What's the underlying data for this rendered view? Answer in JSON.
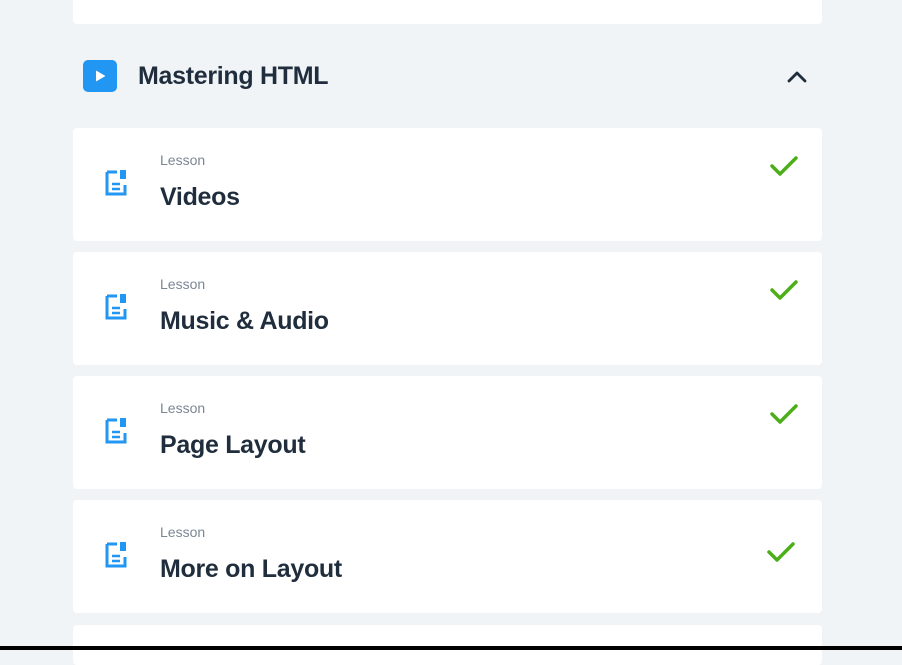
{
  "section": {
    "title": "Mastering HTML",
    "icon": "play-icon",
    "toggle_icon": "chevron-up-icon",
    "accent_color": "#2196f3"
  },
  "lessons": [
    {
      "kind": "Lesson",
      "title": "Videos",
      "icon": "document-icon",
      "status": "completed",
      "status_icon": "checkmark-icon"
    },
    {
      "kind": "Lesson",
      "title": "Music & Audio",
      "icon": "document-icon",
      "status": "completed",
      "status_icon": "checkmark-icon"
    },
    {
      "kind": "Lesson",
      "title": "Page Layout",
      "icon": "document-icon",
      "status": "completed",
      "status_icon": "checkmark-icon"
    },
    {
      "kind": "Lesson",
      "title": "More on Layout",
      "icon": "document-icon",
      "status": "completed",
      "status_icon": "checkmark-icon"
    }
  ],
  "colors": {
    "background": "#f1f4f7",
    "card": "#ffffff",
    "check": "#4caf1a",
    "icon": "#2196f3",
    "title_text": "#1f2d3d",
    "subtle_text": "#7b8794"
  }
}
